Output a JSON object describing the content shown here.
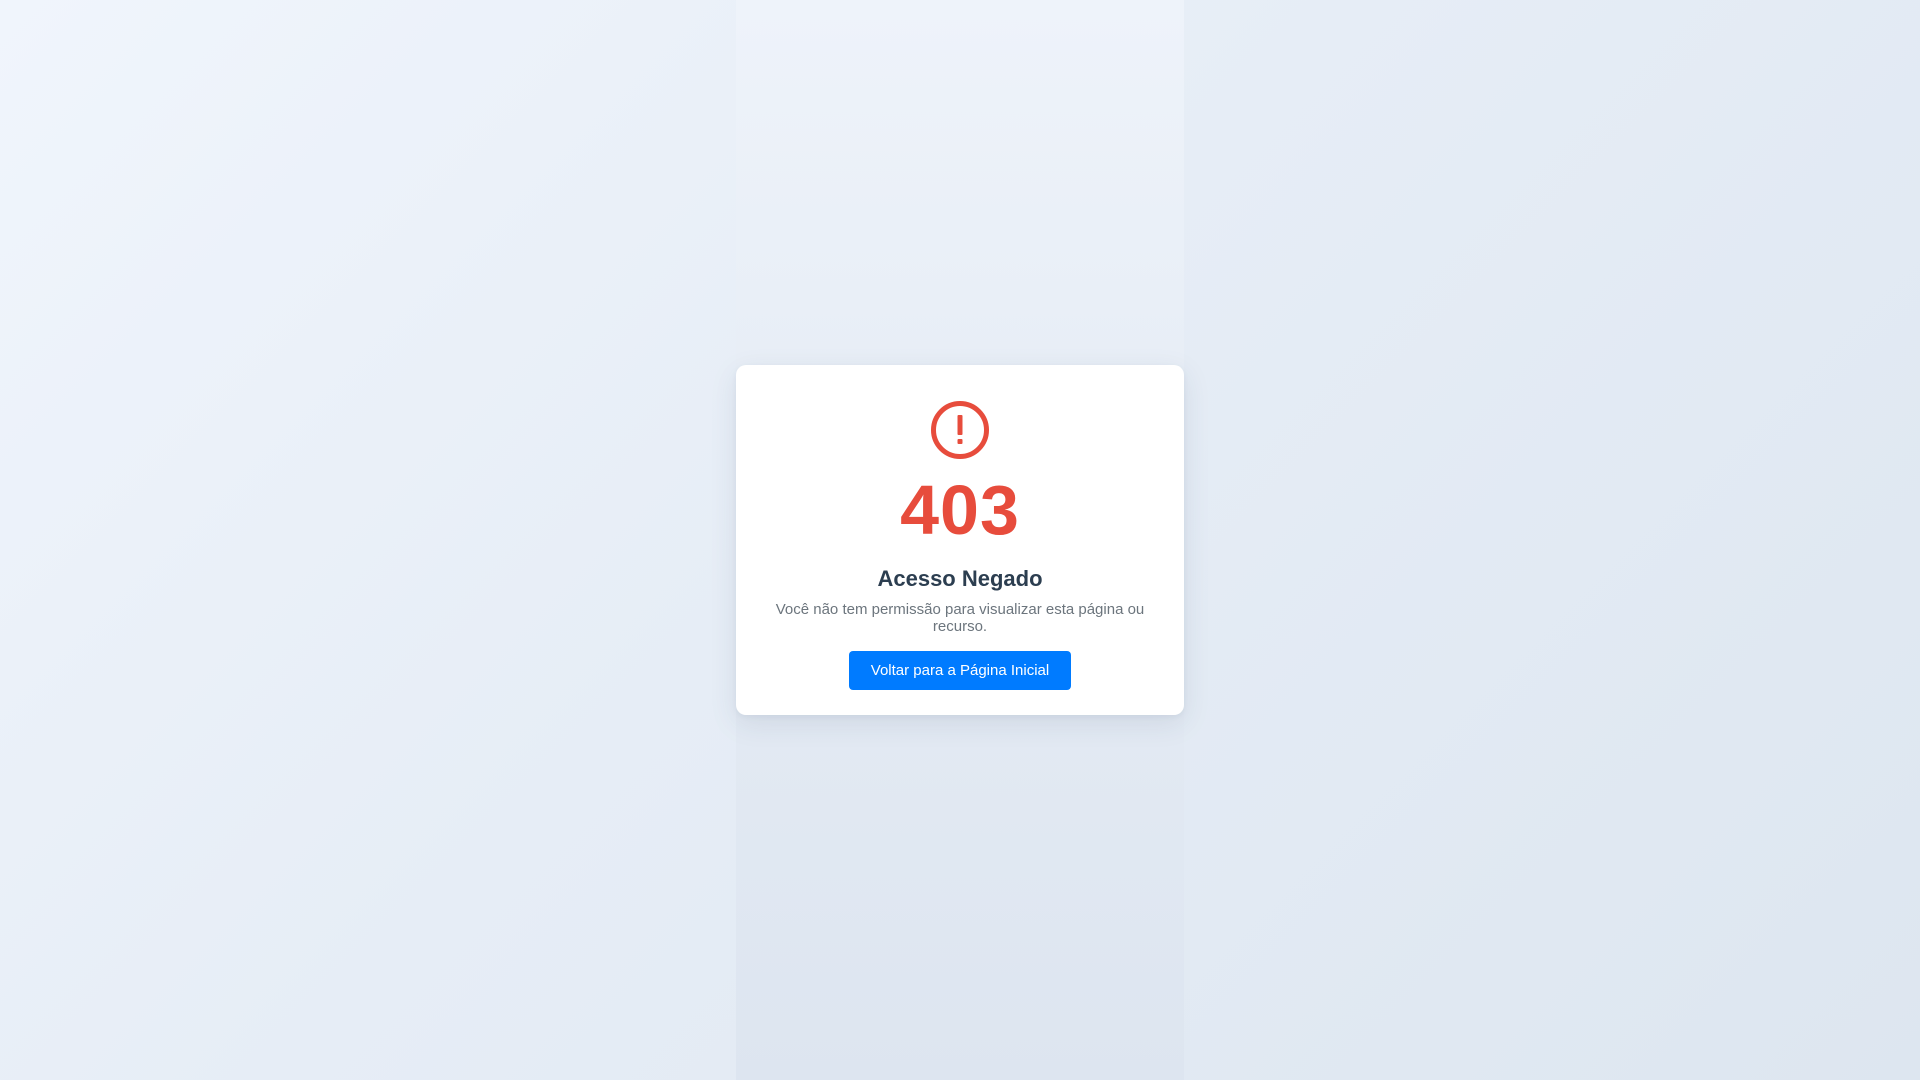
{
  "error": {
    "code": "403",
    "title": "Acesso Negado",
    "message": "Você não tem permissão para visualizar esta página ou recurso.",
    "icon": "alert-circle-icon"
  },
  "actions": {
    "home_button_label": "Voltar para a Página Inicial"
  },
  "colors": {
    "error": "#e74c3c",
    "title": "#2c3e50",
    "message": "#6c757d",
    "button_bg": "#007bff",
    "button_text": "#ffffff",
    "card_bg": "#ffffff"
  }
}
